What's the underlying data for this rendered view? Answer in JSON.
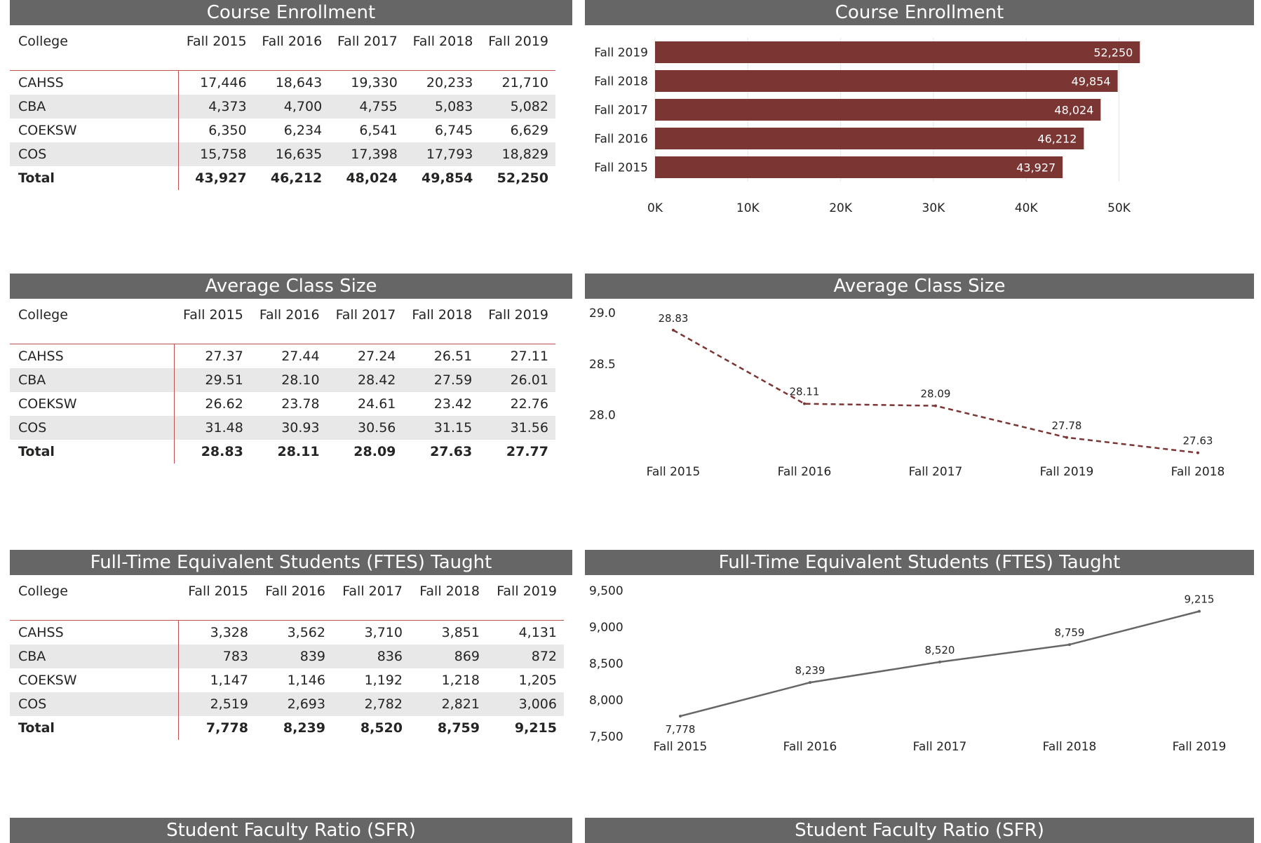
{
  "sections": [
    {
      "table_title": "Course Enrollment",
      "chart_title": "Course Enrollment",
      "table": {
        "columns": [
          "College",
          "Fall 2015",
          "Fall 2016",
          "Fall 2017",
          "Fall 2018",
          "Fall 2019"
        ],
        "rows": [
          [
            "CAHSS",
            "17,446",
            "18,643",
            "19,330",
            "20,233",
            "21,710"
          ],
          [
            "CBA",
            "4,373",
            "4,700",
            "4,755",
            "5,083",
            "5,082"
          ],
          [
            "COEKSW",
            "6,350",
            "6,234",
            "6,541",
            "6,745",
            "6,629"
          ],
          [
            "COS",
            "15,758",
            "16,635",
            "17,398",
            "17,793",
            "18,829"
          ]
        ],
        "total": [
          "Total",
          "43,927",
          "46,212",
          "48,024",
          "49,854",
          "52,250"
        ]
      }
    },
    {
      "table_title": "Average Class Size",
      "chart_title": "Average Class Size",
      "table": {
        "columns": [
          "College",
          "Fall 2015",
          "Fall 2016",
          "Fall 2017",
          "Fall 2018",
          "Fall 2019"
        ],
        "rows": [
          [
            "CAHSS",
            "27.37",
            "27.44",
            "27.24",
            "26.51",
            "27.11"
          ],
          [
            "CBA",
            "29.51",
            "28.10",
            "28.42",
            "27.59",
            "26.01"
          ],
          [
            "COEKSW",
            "26.62",
            "23.78",
            "24.61",
            "23.42",
            "22.76"
          ],
          [
            "COS",
            "31.48",
            "30.93",
            "30.56",
            "31.15",
            "31.56"
          ]
        ],
        "total": [
          "Total",
          "28.83",
          "28.11",
          "28.09",
          "27.63",
          "27.77"
        ]
      }
    },
    {
      "table_title": "Full-Time Equivalent Students (FTES) Taught",
      "chart_title": "Full-Time Equivalent Students (FTES) Taught",
      "table": {
        "columns": [
          "College",
          "Fall 2015",
          "Fall 2016",
          "Fall 2017",
          "Fall 2018",
          "Fall 2019"
        ],
        "rows": [
          [
            "CAHSS",
            "3,328",
            "3,562",
            "3,710",
            "3,851",
            "4,131"
          ],
          [
            "CBA",
            "783",
            "839",
            "836",
            "869",
            "872"
          ],
          [
            "COEKSW",
            "1,147",
            "1,146",
            "1,192",
            "1,218",
            "1,205"
          ],
          [
            "COS",
            "2,519",
            "2,693",
            "2,782",
            "2,821",
            "3,006"
          ]
        ],
        "total": [
          "Total",
          "7,778",
          "8,239",
          "8,520",
          "8,759",
          "9,215"
        ]
      }
    },
    {
      "table_title": "Student Faculty Ratio (SFR)",
      "chart_title": "Student Faculty Ratio (SFR)"
    }
  ],
  "colors": {
    "header_bg": "#666666",
    "bar": "#7b3533",
    "accent_line": "#c0504d",
    "line_dashed": "#7b3533",
    "line_solid": "#666666"
  },
  "chart_data": [
    {
      "type": "bar",
      "orientation": "horizontal",
      "title": "Course Enrollment",
      "categories": [
        "Fall 2019",
        "Fall 2018",
        "Fall 2017",
        "Fall 2016",
        "Fall 2015"
      ],
      "values": [
        52250,
        49854,
        48024,
        46212,
        43927
      ],
      "value_labels": [
        "52,250",
        "49,854",
        "48,024",
        "46,212",
        "43,927"
      ],
      "xlim": [
        0,
        52000
      ],
      "ticks": [
        0,
        10000,
        20000,
        30000,
        40000,
        50000
      ],
      "tick_labels": [
        "0K",
        "10K",
        "20K",
        "30K",
        "40K",
        "50K"
      ],
      "grid": true
    },
    {
      "type": "line",
      "style": "dashed",
      "title": "Average Class Size",
      "categories": [
        "Fall 2015",
        "Fall 2016",
        "Fall 2017",
        "Fall 2019",
        "Fall 2018"
      ],
      "values": [
        28.83,
        28.11,
        28.09,
        27.78,
        27.63
      ],
      "value_labels": [
        "28.83",
        "28.11",
        "28.09",
        "27.78",
        "27.63"
      ],
      "ylim": [
        27.6,
        29.0
      ],
      "ticks": [
        28.0,
        28.5,
        29.0
      ],
      "tick_labels": [
        "28.0",
        "28.5",
        "29.0"
      ],
      "grid": false
    },
    {
      "type": "line",
      "style": "solid",
      "title": "Full-Time Equivalent Students (FTES) Taught",
      "categories": [
        "Fall 2015",
        "Fall 2016",
        "Fall 2017",
        "Fall 2018",
        "Fall 2019"
      ],
      "values": [
        7778,
        8239,
        8520,
        8759,
        9215
      ],
      "value_labels": [
        "7,778",
        "8,239",
        "8,520",
        "8,759",
        "9,215"
      ],
      "ylim": [
        7500,
        9500
      ],
      "ticks": [
        7500,
        8000,
        8500,
        9000,
        9500
      ],
      "tick_labels": [
        "7,500",
        "8,000",
        "8,500",
        "9,000",
        "9,500"
      ],
      "grid": false
    }
  ]
}
